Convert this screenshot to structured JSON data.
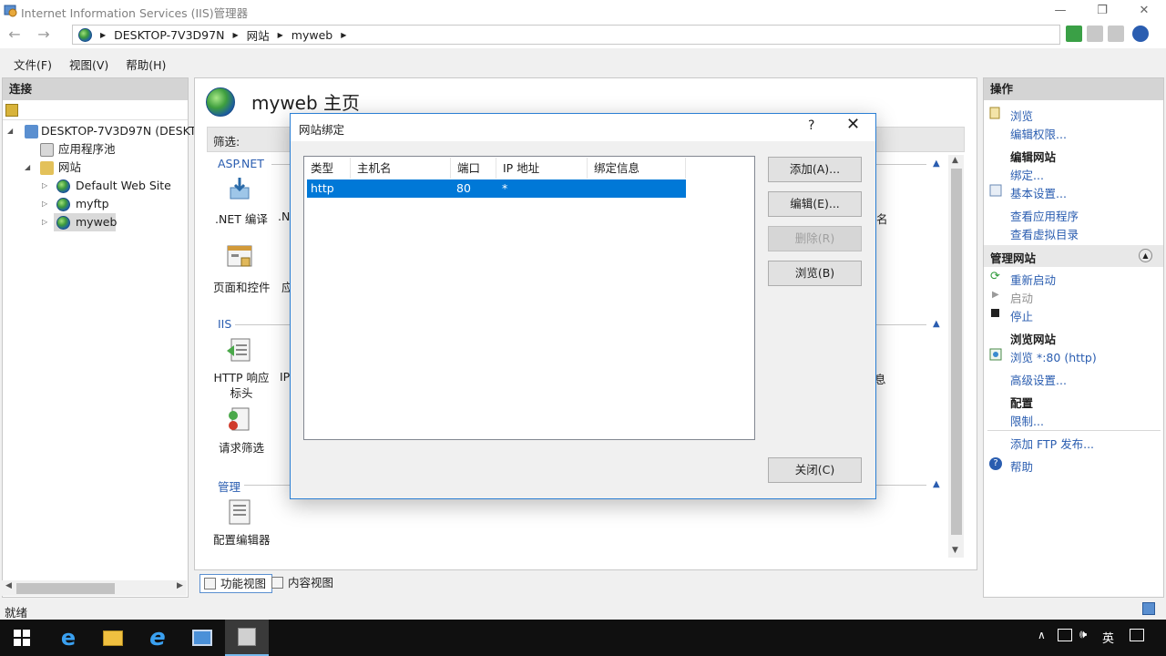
{
  "window": {
    "title": "Internet Information Services (IIS)管理器",
    "minimize": "—",
    "restore": "❐",
    "close": "✕"
  },
  "address": {
    "crumbs": [
      "DESKTOP-7V3D97N",
      "网站",
      "myweb"
    ],
    "separator": "▶"
  },
  "menu": {
    "items": [
      "文件(F)",
      "视图(V)",
      "帮助(H)"
    ]
  },
  "connections": {
    "title": "连接",
    "server": "DESKTOP-7V3D97N (DESKT",
    "app_pools": "应用程序池",
    "sites": "网站",
    "site_list": [
      "Default Web Site",
      "myftp",
      "myweb"
    ]
  },
  "center": {
    "title": "myweb 主页",
    "filter_label": "筛选:",
    "groups": {
      "aspnet": "ASP.NET",
      "iis": "IIS",
      "manage": "管理"
    },
    "features": {
      "net_compile": ".NET 编译",
      "net_partial": ".N",
      "pages_controls": "页面和控件",
      "app_partial": "应",
      "http_headers": "HTTP 响应标头",
      "ip_partial": "IP",
      "request_filter": "请求筛选",
      "config_editor": "配置编辑器",
      "edge_char": "息",
      "edge_char2": "名"
    }
  },
  "view_tabs": {
    "features": "功能视图",
    "content": "内容视图"
  },
  "actions": {
    "title": "操作",
    "browse": "浏览",
    "edit_permissions": "编辑权限...",
    "edit_site": "编辑网站",
    "bindings": "绑定...",
    "basic_settings": "基本设置...",
    "view_apps": "查看应用程序",
    "view_vdirs": "查看虚拟目录",
    "manage_site": "管理网站",
    "restart": "重新启动",
    "start": "启动",
    "stop": "停止",
    "browse_site": "浏览网站",
    "browse_80": "浏览 *:80 (http)",
    "advanced": "高级设置...",
    "config": "配置",
    "limits": "限制...",
    "add_ftp": "添加 FTP 发布...",
    "help": "帮助"
  },
  "status": {
    "text": "就绪"
  },
  "taskbar": {
    "ime": "英"
  },
  "dialog": {
    "title": "网站绑定",
    "help": "?",
    "close": "✕",
    "columns": [
      "类型",
      "主机名",
      "端口",
      "IP 地址",
      "绑定信息"
    ],
    "rows": [
      {
        "type": "http",
        "host": "",
        "port": "80",
        "ip": "*",
        "info": ""
      }
    ],
    "buttons": {
      "add": "添加(A)...",
      "edit": "编辑(E)...",
      "remove": "删除(R)",
      "browse": "浏览(B)",
      "close": "关闭(C)"
    }
  },
  "colors": {
    "selection": "#0078d7",
    "link": "#2a5db0",
    "accent_border": "#2b7fd4"
  }
}
